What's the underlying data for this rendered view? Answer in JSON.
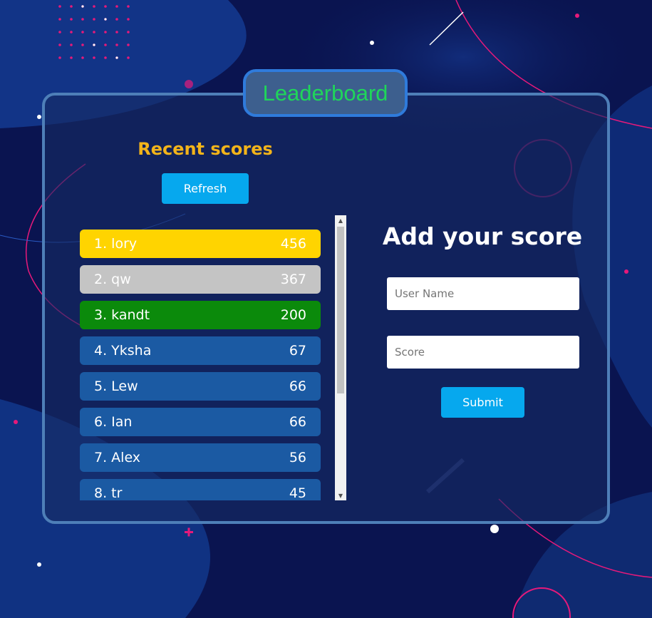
{
  "app": {
    "title": "Leaderboard"
  },
  "recent": {
    "title": "Recent scores",
    "refresh_label": "Refresh",
    "rows": [
      {
        "rank_name": "1. lory",
        "score": "456"
      },
      {
        "rank_name": "2. qw",
        "score": "367"
      },
      {
        "rank_name": "3. kandt",
        "score": "200"
      },
      {
        "rank_name": "4. Yksha",
        "score": "67"
      },
      {
        "rank_name": "5. Lew",
        "score": "66"
      },
      {
        "rank_name": "6. Ian",
        "score": "66"
      },
      {
        "rank_name": "7. Alex",
        "score": "56"
      },
      {
        "rank_name": "8. tr",
        "score": "45"
      }
    ]
  },
  "form": {
    "title": "Add your score",
    "username_placeholder": "User Name",
    "username_value": "",
    "score_placeholder": "Score",
    "score_value": "",
    "submit_label": "Submit"
  },
  "colors": {
    "background": "#0a1450",
    "accent": "#06a8ee",
    "title_green": "#1fd65a",
    "recent_title": "#f3b41a",
    "gold": "#ffd400",
    "silver": "#c4c4c4",
    "bronze": "#0b8a0b",
    "row_default": "#1b5aa3",
    "magenta": "#e6197a"
  },
  "icons": {
    "scroll_up": "triangle-up-icon",
    "scroll_down": "triangle-down-icon",
    "decor_plus": "plus-icon"
  }
}
